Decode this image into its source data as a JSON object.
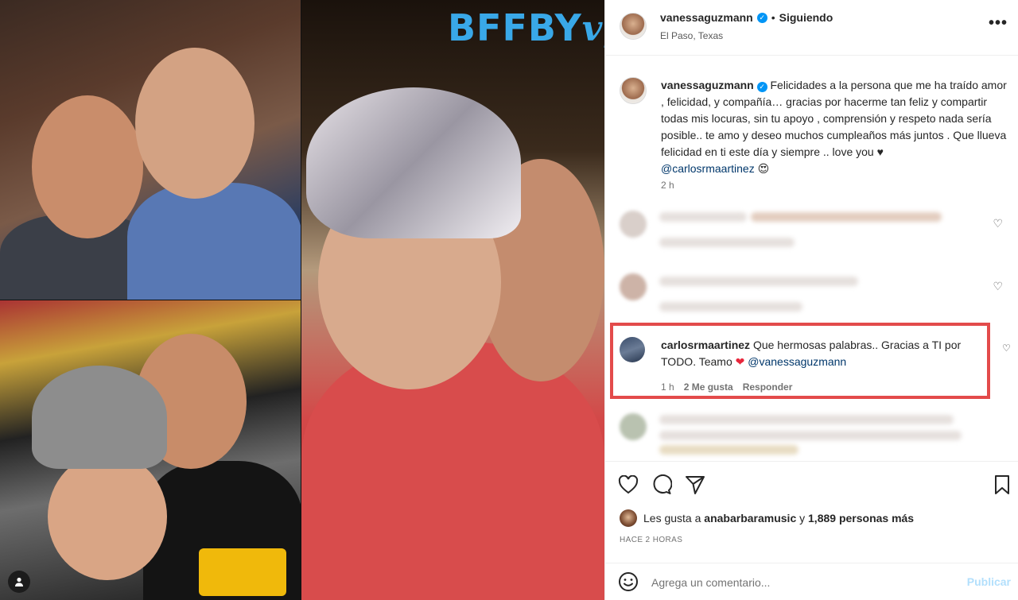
{
  "media": {
    "overlay_logo_main": "BFFBY",
    "overlay_logo_script": "vg"
  },
  "header": {
    "username": "vanessaguzmann",
    "separator": "•",
    "follow_status": "Siguiendo",
    "location": "El Paso, Texas",
    "more_glyph": "•••"
  },
  "caption": {
    "username": "vanessaguzmann",
    "text": "Felicidades a la persona que me ha traído amor , felicidad, y compañía… gracias por hacerme tan feliz y compartir todas mis locuras, sin tu apoyo , comprensión y respeto nada sería posible.. te amo y deseo muchos cumpleaños más juntos . Que llueva felicidad en ti este día y siempre .. love you ♥ ",
    "mention": "@carlosrmaartinez",
    "emoji": "😍",
    "time": "2 h"
  },
  "highlighted_comment": {
    "username": "carlosrmaartinez",
    "text": "Que hermosas palabras.. Gracias a TI por TODO. Teamo",
    "heart": "❤",
    "mention": "@vanessaguzmann",
    "time": "1 h",
    "likes": "2 Me gusta",
    "reply": "Responder"
  },
  "likes": {
    "prefix": "Les gusta a",
    "user": "anabarbaramusic",
    "connector": "y",
    "others": "1,889 personas más"
  },
  "post_time": "HACE 2 HORAS",
  "comment_box": {
    "placeholder": "Agrega un comentario...",
    "publish_label": "Publicar"
  },
  "colors": {
    "accent": "#0095f6",
    "highlight_box": "#e34b4b",
    "mention": "#00376b",
    "logo": "#39a8e8"
  },
  "icons": [
    "verified-badge-icon",
    "more-options-icon",
    "heart-icon",
    "comment-icon",
    "share-icon",
    "bookmark-icon",
    "emoji-icon",
    "user-tag-icon"
  ]
}
